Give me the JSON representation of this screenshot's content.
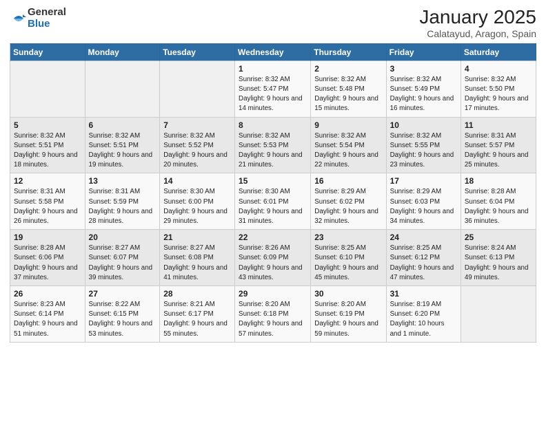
{
  "header": {
    "logo_general": "General",
    "logo_blue": "Blue",
    "title": "January 2025",
    "subtitle": "Calatayud, Aragon, Spain"
  },
  "days_of_week": [
    "Sunday",
    "Monday",
    "Tuesday",
    "Wednesday",
    "Thursday",
    "Friday",
    "Saturday"
  ],
  "weeks": [
    [
      {
        "day": "",
        "sunrise": "",
        "sunset": "",
        "daylight": ""
      },
      {
        "day": "",
        "sunrise": "",
        "sunset": "",
        "daylight": ""
      },
      {
        "day": "",
        "sunrise": "",
        "sunset": "",
        "daylight": ""
      },
      {
        "day": "1",
        "sunrise": "Sunrise: 8:32 AM",
        "sunset": "Sunset: 5:47 PM",
        "daylight": "Daylight: 9 hours and 14 minutes."
      },
      {
        "day": "2",
        "sunrise": "Sunrise: 8:32 AM",
        "sunset": "Sunset: 5:48 PM",
        "daylight": "Daylight: 9 hours and 15 minutes."
      },
      {
        "day": "3",
        "sunrise": "Sunrise: 8:32 AM",
        "sunset": "Sunset: 5:49 PM",
        "daylight": "Daylight: 9 hours and 16 minutes."
      },
      {
        "day": "4",
        "sunrise": "Sunrise: 8:32 AM",
        "sunset": "Sunset: 5:50 PM",
        "daylight": "Daylight: 9 hours and 17 minutes."
      }
    ],
    [
      {
        "day": "5",
        "sunrise": "Sunrise: 8:32 AM",
        "sunset": "Sunset: 5:51 PM",
        "daylight": "Daylight: 9 hours and 18 minutes."
      },
      {
        "day": "6",
        "sunrise": "Sunrise: 8:32 AM",
        "sunset": "Sunset: 5:51 PM",
        "daylight": "Daylight: 9 hours and 19 minutes."
      },
      {
        "day": "7",
        "sunrise": "Sunrise: 8:32 AM",
        "sunset": "Sunset: 5:52 PM",
        "daylight": "Daylight: 9 hours and 20 minutes."
      },
      {
        "day": "8",
        "sunrise": "Sunrise: 8:32 AM",
        "sunset": "Sunset: 5:53 PM",
        "daylight": "Daylight: 9 hours and 21 minutes."
      },
      {
        "day": "9",
        "sunrise": "Sunrise: 8:32 AM",
        "sunset": "Sunset: 5:54 PM",
        "daylight": "Daylight: 9 hours and 22 minutes."
      },
      {
        "day": "10",
        "sunrise": "Sunrise: 8:32 AM",
        "sunset": "Sunset: 5:55 PM",
        "daylight": "Daylight: 9 hours and 23 minutes."
      },
      {
        "day": "11",
        "sunrise": "Sunrise: 8:31 AM",
        "sunset": "Sunset: 5:57 PM",
        "daylight": "Daylight: 9 hours and 25 minutes."
      }
    ],
    [
      {
        "day": "12",
        "sunrise": "Sunrise: 8:31 AM",
        "sunset": "Sunset: 5:58 PM",
        "daylight": "Daylight: 9 hours and 26 minutes."
      },
      {
        "day": "13",
        "sunrise": "Sunrise: 8:31 AM",
        "sunset": "Sunset: 5:59 PM",
        "daylight": "Daylight: 9 hours and 28 minutes."
      },
      {
        "day": "14",
        "sunrise": "Sunrise: 8:30 AM",
        "sunset": "Sunset: 6:00 PM",
        "daylight": "Daylight: 9 hours and 29 minutes."
      },
      {
        "day": "15",
        "sunrise": "Sunrise: 8:30 AM",
        "sunset": "Sunset: 6:01 PM",
        "daylight": "Daylight: 9 hours and 31 minutes."
      },
      {
        "day": "16",
        "sunrise": "Sunrise: 8:29 AM",
        "sunset": "Sunset: 6:02 PM",
        "daylight": "Daylight: 9 hours and 32 minutes."
      },
      {
        "day": "17",
        "sunrise": "Sunrise: 8:29 AM",
        "sunset": "Sunset: 6:03 PM",
        "daylight": "Daylight: 9 hours and 34 minutes."
      },
      {
        "day": "18",
        "sunrise": "Sunrise: 8:28 AM",
        "sunset": "Sunset: 6:04 PM",
        "daylight": "Daylight: 9 hours and 36 minutes."
      }
    ],
    [
      {
        "day": "19",
        "sunrise": "Sunrise: 8:28 AM",
        "sunset": "Sunset: 6:06 PM",
        "daylight": "Daylight: 9 hours and 37 minutes."
      },
      {
        "day": "20",
        "sunrise": "Sunrise: 8:27 AM",
        "sunset": "Sunset: 6:07 PM",
        "daylight": "Daylight: 9 hours and 39 minutes."
      },
      {
        "day": "21",
        "sunrise": "Sunrise: 8:27 AM",
        "sunset": "Sunset: 6:08 PM",
        "daylight": "Daylight: 9 hours and 41 minutes."
      },
      {
        "day": "22",
        "sunrise": "Sunrise: 8:26 AM",
        "sunset": "Sunset: 6:09 PM",
        "daylight": "Daylight: 9 hours and 43 minutes."
      },
      {
        "day": "23",
        "sunrise": "Sunrise: 8:25 AM",
        "sunset": "Sunset: 6:10 PM",
        "daylight": "Daylight: 9 hours and 45 minutes."
      },
      {
        "day": "24",
        "sunrise": "Sunrise: 8:25 AM",
        "sunset": "Sunset: 6:12 PM",
        "daylight": "Daylight: 9 hours and 47 minutes."
      },
      {
        "day": "25",
        "sunrise": "Sunrise: 8:24 AM",
        "sunset": "Sunset: 6:13 PM",
        "daylight": "Daylight: 9 hours and 49 minutes."
      }
    ],
    [
      {
        "day": "26",
        "sunrise": "Sunrise: 8:23 AM",
        "sunset": "Sunset: 6:14 PM",
        "daylight": "Daylight: 9 hours and 51 minutes."
      },
      {
        "day": "27",
        "sunrise": "Sunrise: 8:22 AM",
        "sunset": "Sunset: 6:15 PM",
        "daylight": "Daylight: 9 hours and 53 minutes."
      },
      {
        "day": "28",
        "sunrise": "Sunrise: 8:21 AM",
        "sunset": "Sunset: 6:17 PM",
        "daylight": "Daylight: 9 hours and 55 minutes."
      },
      {
        "day": "29",
        "sunrise": "Sunrise: 8:20 AM",
        "sunset": "Sunset: 6:18 PM",
        "daylight": "Daylight: 9 hours and 57 minutes."
      },
      {
        "day": "30",
        "sunrise": "Sunrise: 8:20 AM",
        "sunset": "Sunset: 6:19 PM",
        "daylight": "Daylight: 9 hours and 59 minutes."
      },
      {
        "day": "31",
        "sunrise": "Sunrise: 8:19 AM",
        "sunset": "Sunset: 6:20 PM",
        "daylight": "Daylight: 10 hours and 1 minute."
      },
      {
        "day": "",
        "sunrise": "",
        "sunset": "",
        "daylight": ""
      }
    ]
  ]
}
